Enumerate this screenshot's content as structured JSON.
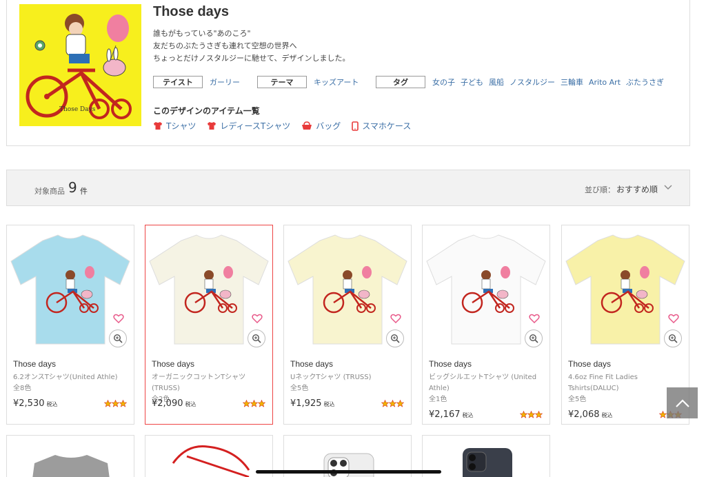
{
  "design": {
    "title": "Those days",
    "description": [
      "誰もがもっている\"あのころ\"",
      "友だちのぶたうさぎも連れて空想の世界へ",
      "ちょっとだけノスタルジーに馳せて、デザインしました。"
    ],
    "art_caption": "Those Days",
    "taste": {
      "label": "テイスト",
      "value": "ガーリー"
    },
    "theme": {
      "label": "テーマ",
      "value": "キッズアート"
    },
    "tags": {
      "label": "タグ",
      "values": [
        "女の子",
        "子ども",
        "風船",
        "ノスタルジー",
        "三輪車",
        "Arito Art",
        "ぶたうさぎ"
      ]
    },
    "items_heading": "このデザインのアイテム一覧",
    "categories": [
      {
        "label": "Tシャツ",
        "icon": "tshirt-icon"
      },
      {
        "label": "レディースTシャツ",
        "icon": "tshirt-icon"
      },
      {
        "label": "バッグ",
        "icon": "bag-icon"
      },
      {
        "label": "スマホケース",
        "icon": "phone-icon"
      }
    ]
  },
  "results": {
    "count_label": "対象商品",
    "count": "9",
    "count_unit": "件",
    "sort_label": "並び順：",
    "sort_value": "おすすめ順"
  },
  "products": [
    {
      "name": "Those days",
      "type": "6.2オンスTシャツ(United Athle)",
      "colors": "全8色",
      "price": "¥2,530",
      "tax": "税込",
      "shirt_color": "#a8dcec"
    },
    {
      "name": "Those days",
      "type": "オーガニックコットンTシャツ (TRUSS)",
      "colors": "全2色",
      "price": "¥2,090",
      "tax": "税込",
      "shirt_color": "#f5f3e4"
    },
    {
      "name": "Those days",
      "type": "UネックTシャツ (TRUSS)",
      "colors": "全5色",
      "price": "¥1,925",
      "tax": "税込",
      "shirt_color": "#f8f4cf"
    },
    {
      "name": "Those days",
      "type": "ビッグシルエットTシャツ (United Athle)",
      "colors": "全1色",
      "price": "¥2,167",
      "tax": "税込",
      "shirt_color": "#fafafa"
    },
    {
      "name": "Those days",
      "type": "4.6oz Fine Fit Ladies Tshirts(DALUC)",
      "colors": "全5色",
      "price": "¥2,068",
      "tax": "税込",
      "shirt_color": "#f8f1a8"
    }
  ],
  "colors": {
    "accent": "#e83a3a",
    "link": "#3a6ea5",
    "heart": "#e85a8a",
    "star": "#f0b400"
  }
}
